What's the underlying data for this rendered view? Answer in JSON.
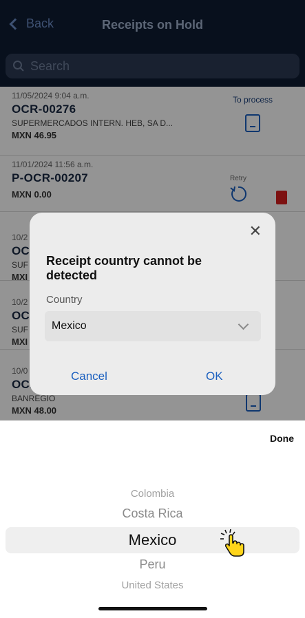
{
  "nav": {
    "back_label": "Back",
    "title": "Receipts on Hold"
  },
  "search": {
    "placeholder": "Search"
  },
  "receipts": [
    {
      "date": "11/05/2024 9:04 a.m.",
      "code": "OCR-00276",
      "vendor": "SUPERMERCADOS INTERN. HEB, SA D...",
      "amount": "MXN 46.95",
      "action": "To process"
    },
    {
      "date": "11/01/2024 11:56 a.m.",
      "code": "P-OCR-00207",
      "vendor": "",
      "amount": "MXN 0.00",
      "action": "Retry"
    },
    {
      "date": "10/2",
      "code": "OC",
      "vendor": "SUF",
      "amount": "MXI"
    },
    {
      "date": "10/2",
      "code": "OC",
      "vendor": "SUF",
      "amount": "MXI"
    },
    {
      "date": "10/0",
      "code": "OCI",
      "vendor": "BANREGIO",
      "amount": "MXN 48.00"
    }
  ],
  "modal": {
    "message": "Receipt country cannot be detected",
    "field_label": "Country",
    "selected_value": "Mexico",
    "cancel_label": "Cancel",
    "ok_label": "OK"
  },
  "picker": {
    "done_label": "Done",
    "options": [
      "Colombia",
      "Costa Rica",
      "Mexico",
      "Peru",
      "United States"
    ],
    "selected": "Mexico"
  },
  "colors": {
    "accent": "#1a5fbf",
    "navbar": "#0f1c33",
    "delete": "#d81e1e"
  }
}
